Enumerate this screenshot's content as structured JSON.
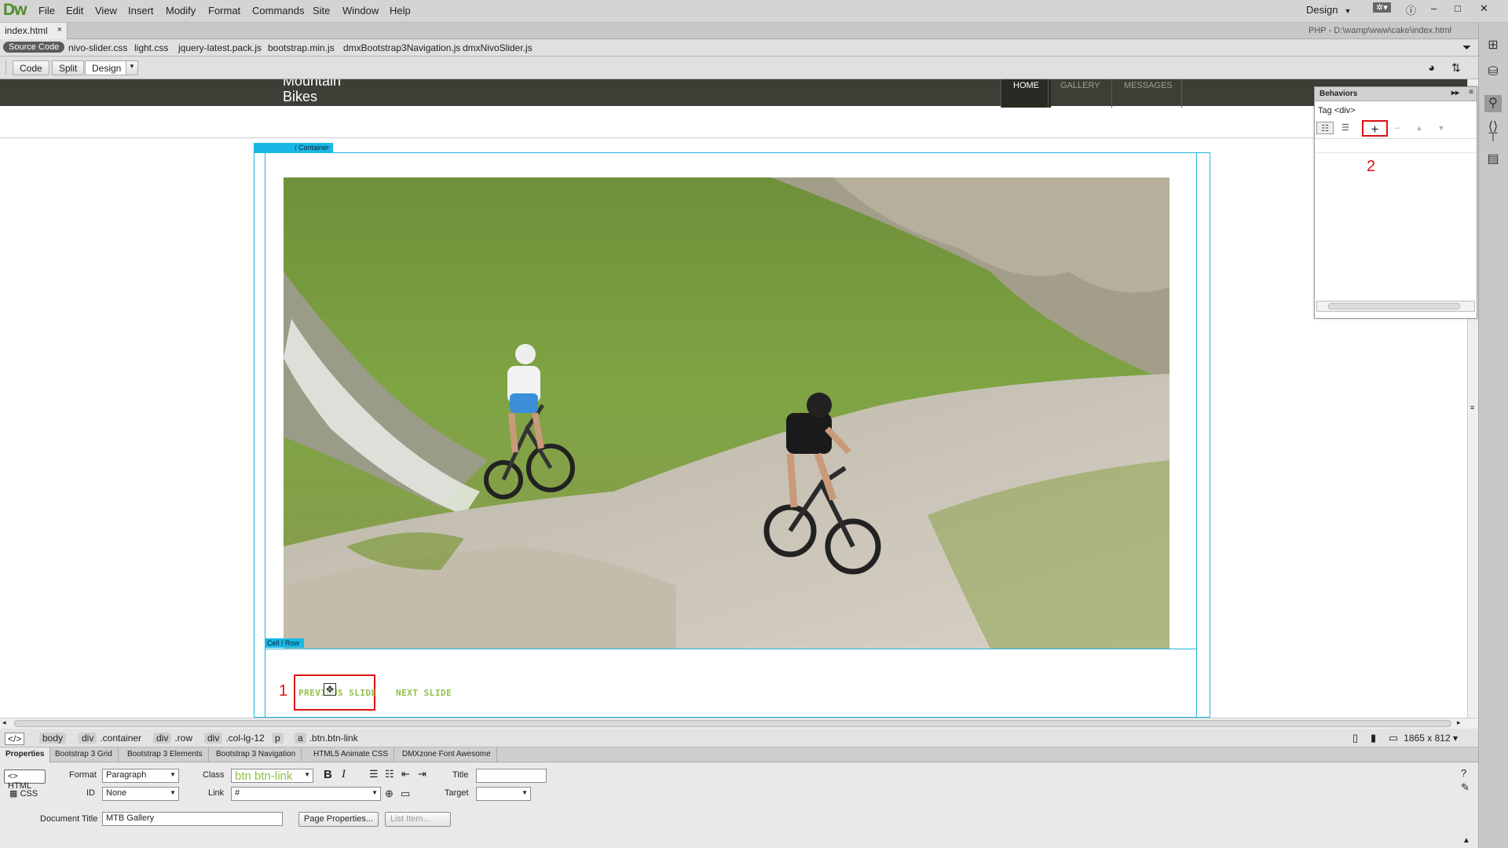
{
  "app": {
    "logo": "Dw"
  },
  "menu": [
    "File",
    "Edit",
    "View",
    "Insert",
    "Modify",
    "Format",
    "Commands",
    "Site",
    "Window",
    "Help"
  ],
  "workspace": {
    "label": "Design"
  },
  "document_tab": {
    "name": "index.html",
    "close": "×"
  },
  "document_path": "PHP - D:\\wamp\\www\\cake\\index.html",
  "related_files": {
    "source_code": "Source Code",
    "files": [
      "nivo-slider.css",
      "light.css",
      "jquery-latest.pack.js",
      "bootstrap.min.js",
      "dmxBootstrap3Navigation.js",
      "dmxNivoSlider.js"
    ]
  },
  "view_buttons": {
    "code": "Code",
    "split": "Split",
    "design": "Design"
  },
  "page": {
    "brand_line1": "Mountain",
    "brand_line2": "Bikes",
    "nav": [
      "HOME",
      "GALLERY",
      "MESSAGES"
    ],
    "container_label": "/ Container",
    "row_label": "Cell / Row",
    "prev_button": "PREVIOUS SLIDE",
    "next_button": "NEXT SLIDE"
  },
  "annotations": {
    "one": "1",
    "two": "2"
  },
  "tag_selector": {
    "root": "</>",
    "crumbs": [
      "body",
      ".container",
      "div",
      ".row",
      "div",
      ".col-lg-12",
      "p",
      "a",
      ".btn.btn-link"
    ],
    "window_size": "1865 x 812"
  },
  "inspector_tabs": [
    "Properties",
    "Bootstrap 3 Grid",
    "Bootstrap 3 Elements",
    "Bootstrap 3 Navigation",
    "HTML5 Animate CSS",
    "DMXzone Font Awesome"
  ],
  "properties": {
    "html_label": "HTML",
    "css_label": "CSS",
    "format_label": "Format",
    "format_value": "Paragraph",
    "class_label": "Class",
    "class_value": "btn btn-link",
    "title_label": "Title",
    "id_label": "ID",
    "id_value": "None",
    "link_label": "Link",
    "link_value": "#",
    "target_label": "Target",
    "doc_title_label": "Document Title",
    "doc_title_value": "MTB Gallery",
    "page_properties": "Page Properties...",
    "list_item": "List Item..."
  },
  "behaviors": {
    "title": "Behaviors",
    "tag": "Tag <div>",
    "add": "+"
  },
  "colors": {
    "accent_green": "#8fc14a",
    "guide_cyan": "#18b7e6",
    "annotation_red": "#dd1111",
    "header_dark": "#3e3e37"
  }
}
